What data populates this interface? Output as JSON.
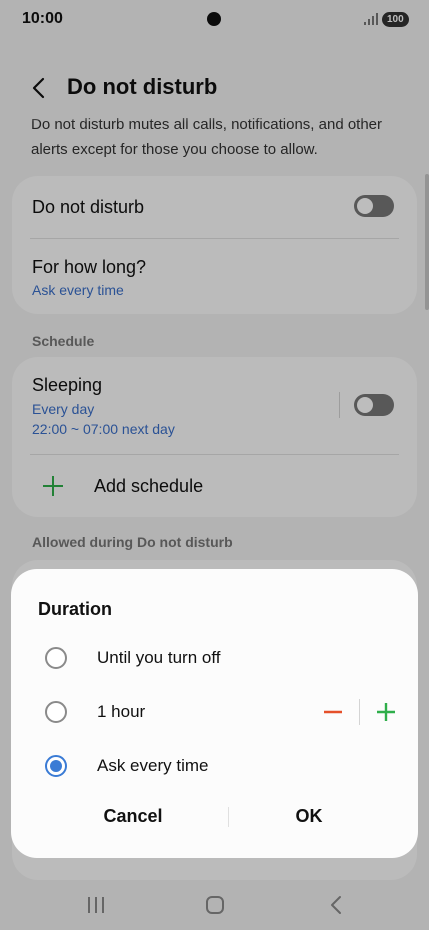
{
  "status_bar": {
    "time": "10:00",
    "battery": "100",
    "icons": [
      "camera-dot",
      "signal-icon",
      "battery-icon"
    ]
  },
  "header": {
    "title": "Do not disturb",
    "back_icon": "chevron-left-icon"
  },
  "description": "Do not disturb mutes all calls, notifications, and other alerts except for those you choose to allow.",
  "main_card": {
    "dnd_label": "Do not disturb",
    "dnd_enabled": false,
    "how_long_label": "For how long?",
    "how_long_value": "Ask every time"
  },
  "schedule": {
    "section_label": "Schedule",
    "sleeping": {
      "title": "Sleeping",
      "days": "Every day",
      "time": "22:00 ~ 07:00 next day",
      "enabled": false
    },
    "add_label": "Add schedule"
  },
  "allowed_section_label": "Allowed during Do not disturb",
  "dialog": {
    "title": "Duration",
    "options": [
      {
        "label": "Until you turn off",
        "selected": false
      },
      {
        "label": "1 hour",
        "selected": false
      },
      {
        "label": "Ask every time",
        "selected": true
      }
    ],
    "cancel_label": "Cancel",
    "ok_label": "OK"
  },
  "colors": {
    "accent_blue": "#3a6fc9",
    "radio_blue": "#3a7bd5",
    "plus_green": "#2fae4a",
    "minus_red": "#e5502a"
  },
  "nav_bar": {
    "icons": [
      "recents-icon",
      "home-icon",
      "back-icon"
    ]
  }
}
